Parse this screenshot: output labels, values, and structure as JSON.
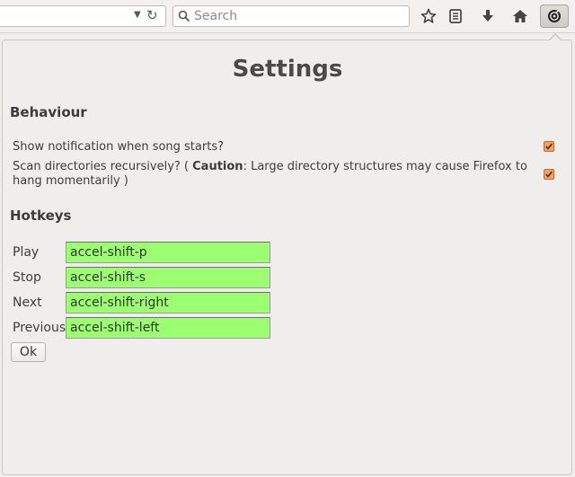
{
  "toolbar": {
    "search_placeholder": "Search",
    "icons": [
      "chevron-down-icon",
      "reload-icon",
      "search-icon",
      "star-icon",
      "reading-list-icon",
      "download-icon",
      "home-icon",
      "addon-icon"
    ]
  },
  "settings": {
    "title": "Settings",
    "behaviour": {
      "heading": "Behaviour",
      "show_notification": {
        "label": "Show notification when song starts?",
        "checked": true
      },
      "scan_recursive": {
        "label_before": "Scan directories recursively? ( ",
        "caution": "Caution",
        "label_after": ": Large directory structures may cause Firefox to",
        "label_line2": "hang momentarily )",
        "checked": true
      }
    },
    "hotkeys": {
      "heading": "Hotkeys",
      "items": [
        {
          "label": "Play",
          "value": "accel-shift-p"
        },
        {
          "label": "Stop",
          "value": "accel-shift-s"
        },
        {
          "label": "Next",
          "value": "accel-shift-right"
        },
        {
          "label": "Previous",
          "value": "accel-shift-left"
        }
      ]
    },
    "ok_label": "Ok"
  },
  "colors": {
    "hotkey_field_bg": "#9cff72",
    "checkbox": "#f0a060"
  }
}
